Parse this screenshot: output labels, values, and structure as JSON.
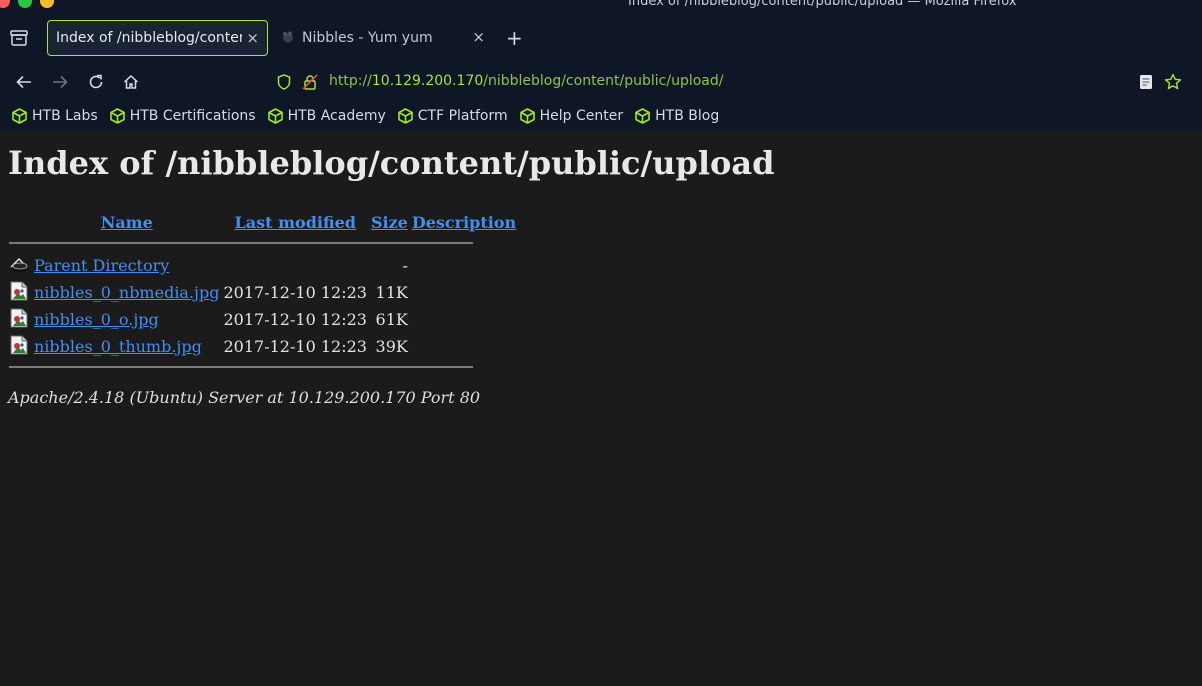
{
  "window": {
    "title": "Index of /nibbleblog/content/public/upload — Mozilla Firefox"
  },
  "tabs": [
    {
      "label": "Index of /nibbleblog/content/public/upload",
      "active": true,
      "close": "×"
    },
    {
      "label": "Nibbles - Yum yum",
      "active": false,
      "close": "×"
    }
  ],
  "new_tab": "+",
  "url": {
    "scheme": "http://",
    "host": "10.129.200.170",
    "path": "/nibbleblog/content/public/upload/"
  },
  "bookmarks": [
    {
      "label": "HTB Labs",
      "icon": "htb-cube-icon"
    },
    {
      "label": "HTB Certifications",
      "icon": "htb-cube-icon"
    },
    {
      "label": "HTB Academy",
      "icon": "htb-cube-icon"
    },
    {
      "label": "CTF Platform",
      "icon": "htb-cube-icon"
    },
    {
      "label": "Help Center",
      "icon": "htb-cube-icon"
    },
    {
      "label": "HTB Blog",
      "icon": "htb-cube-icon"
    }
  ],
  "page": {
    "heading": "Index of /nibbleblog/content/public/upload",
    "columns": {
      "name": "Name",
      "last_modified": "Last modified",
      "size": "Size",
      "description": "Description"
    },
    "parent": {
      "name": "Parent Directory",
      "size": "-",
      "icon": "back-icon"
    },
    "files": [
      {
        "name": "nibbles_0_nbmedia.jpg",
        "modified": "2017-12-10 12:23",
        "size": "11K",
        "icon": "image-file-icon"
      },
      {
        "name": "nibbles_0_o.jpg",
        "modified": "2017-12-10 12:23",
        "size": "61K",
        "icon": "image-file-icon"
      },
      {
        "name": "nibbles_0_thumb.jpg",
        "modified": "2017-12-10 12:23",
        "size": "39K",
        "icon": "image-file-icon"
      }
    ],
    "footer": "Apache/2.4.18 (Ubuntu) Server at 10.129.200.170 Port 80"
  },
  "colors": {
    "accent": "#a3e635",
    "link": "#3f8ff6",
    "chrome_bg": "#0f1626",
    "page_bg": "#1b1b1b"
  }
}
